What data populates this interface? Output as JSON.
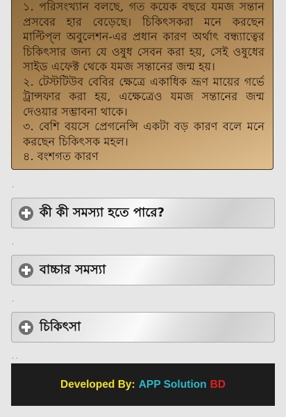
{
  "info": {
    "lines": [
      "১. পরিসংখ্যান বলছে, গত কয়েক বছরে যমজ সন্তান",
      "প্রসবের হার বেড়েছে। চিকিৎসকরা মনে করছেন",
      "মাল্টিপ্‌ল অবুলেশন-এর প্রধান কারণ অর্থাৎ বন্ধ্যাত্বের",
      "চিকিৎসার জন্য যে ওষুধ সেবন করা হয়, সেই ওষুধের",
      "সাইড এফেক্ট থেকে যমজ সন্তানের জন্ম হয়।",
      "২. টেস্টটিউব বেবির ক্ষেত্রে একাধিক ভ্রূণ মায়ের গর্ভে",
      "ট্রান্সফার করা হয়, এক্ষেত্রেও যমজ সন্তানের জন্ম",
      "দেওয়ার সম্ভাবনা থাকে।",
      "৩. বেশি বয়সে প্রেগনেন্সি একটা বড় কারণ বলে মনে",
      "করছেন চিকিৎসক মহল।",
      "৪. বংশগত কারণ"
    ]
  },
  "separators": {
    "s1": ".",
    "s2": ".",
    "s3": ".",
    "s4": ". ."
  },
  "accordion": [
    {
      "title": "কী কী সমস্যা হতে পারে?",
      "icon": "plus-circle-icon"
    },
    {
      "title": "বাচ্চার সমস্যা",
      "icon": "plus-circle-icon"
    },
    {
      "title": "চিকিৎসা",
      "icon": "plus-circle-icon"
    }
  ],
  "footer": {
    "label": "Developed By:",
    "name_part1": "APP Solution",
    "name_part2": "BD",
    "colors": {
      "label": "#f2e21a",
      "part1": "#2bb9c7",
      "part2": "#e0211b",
      "background": "#1d1d1d"
    }
  }
}
